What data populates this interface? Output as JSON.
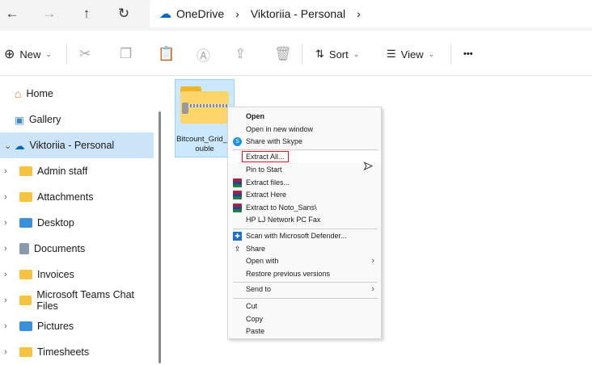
{
  "breadcrumb": [
    "OneDrive",
    "Viktoriia - Personal"
  ],
  "toolbar": {
    "new": "New",
    "sort": "Sort",
    "view": "View",
    "more": "•••"
  },
  "sidebar": {
    "items": [
      {
        "label": "Home",
        "icon": "home-icon"
      },
      {
        "label": "Gallery",
        "icon": "gallery-icon"
      },
      {
        "label": "Viktoriia - Personal",
        "icon": "cloud-icon",
        "selected": true
      },
      {
        "label": "Admin staff",
        "icon": "folder-icon"
      },
      {
        "label": "Attachments",
        "icon": "folder-icon"
      },
      {
        "label": "Desktop",
        "icon": "folder-icon"
      },
      {
        "label": "Documents",
        "icon": "documents-icon"
      },
      {
        "label": "Invoices",
        "icon": "folder-icon"
      },
      {
        "label": "Microsoft Teams Chat Files",
        "icon": "folder-icon"
      },
      {
        "label": "Pictures",
        "icon": "pictures-icon"
      },
      {
        "label": "Timesheets",
        "icon": "folder-icon"
      }
    ]
  },
  "file": {
    "name_line1": "Bitcount_Grid_D",
    "name_line2": "ouble"
  },
  "menu": {
    "items": [
      "Open",
      "Open in new window",
      "Share with Skype",
      "Extract All...",
      "Pin to Start",
      "Extract files...",
      "Extract Here",
      "Extract to Noto_Sans\\",
      "HP LJ Network PC Fax",
      "Scan with Microsoft Defender...",
      "Share",
      "Open with",
      "Restore previous versions",
      "Send to",
      "Cut",
      "Copy",
      "Paste"
    ]
  },
  "colors": {
    "selection": "#cce4f7",
    "highlight_box": "#e81123",
    "accent": "#0067c0"
  }
}
